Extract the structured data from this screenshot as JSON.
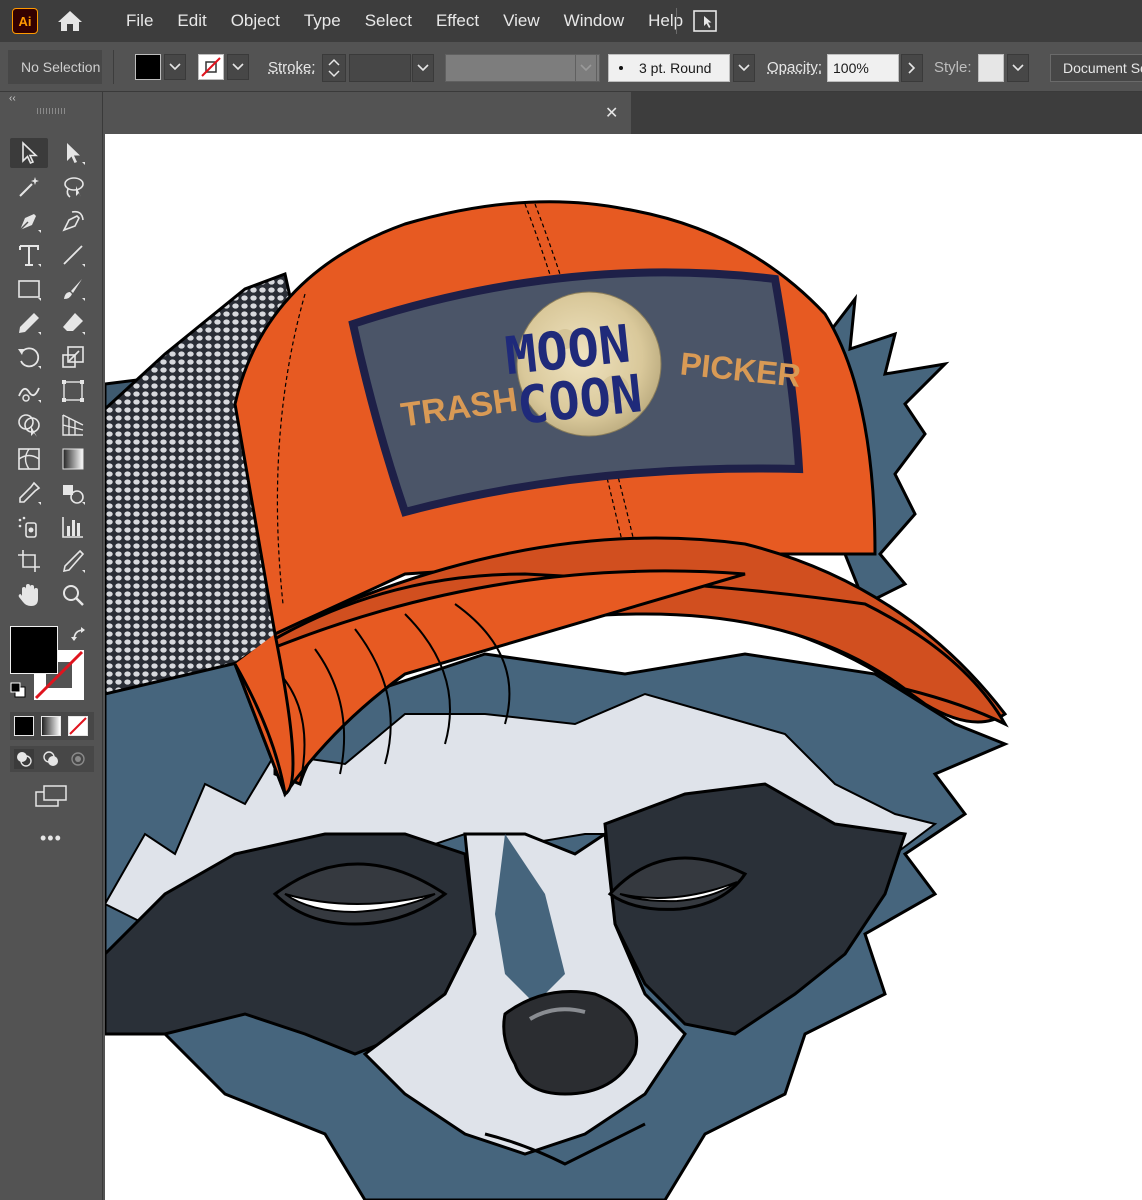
{
  "app": {
    "logo_text": "Ai"
  },
  "menu": [
    "File",
    "Edit",
    "Object",
    "Type",
    "Select",
    "Effect",
    "View",
    "Window",
    "Help"
  ],
  "control_bar": {
    "selection_status": "No Selection",
    "stroke_label": "Stroke:",
    "brush": "3 pt. Round",
    "opacity_label": "Opacity:",
    "opacity_value": "100%",
    "style_label": "Style:",
    "document_setup": "Document Setup"
  },
  "tools": [
    {
      "name": "selection-tool-icon",
      "active": true
    },
    {
      "name": "direct-selection-tool-icon"
    },
    {
      "name": "magic-wand-tool-icon"
    },
    {
      "name": "lasso-tool-icon"
    },
    {
      "name": "pen-tool-icon"
    },
    {
      "name": "curvature-tool-icon"
    },
    {
      "name": "type-tool-icon"
    },
    {
      "name": "line-tool-icon"
    },
    {
      "name": "rectangle-tool-icon"
    },
    {
      "name": "paintbrush-tool-icon"
    },
    {
      "name": "pencil-tool-icon"
    },
    {
      "name": "eraser-tool-icon"
    },
    {
      "name": "rotate-tool-icon"
    },
    {
      "name": "scale-tool-icon"
    },
    {
      "name": "warp-tool-icon"
    },
    {
      "name": "free-transform-tool-icon"
    },
    {
      "name": "shape-builder-tool-icon"
    },
    {
      "name": "perspective-grid-tool-icon"
    },
    {
      "name": "mesh-tool-icon"
    },
    {
      "name": "gradient-tool-icon"
    },
    {
      "name": "eyedropper-tool-icon"
    },
    {
      "name": "blend-tool-icon"
    },
    {
      "name": "symbol-sprayer-tool-icon"
    },
    {
      "name": "column-graph-tool-icon"
    },
    {
      "name": "artboard-tool-icon"
    },
    {
      "name": "slice-tool-icon"
    },
    {
      "name": "hand-tool-icon"
    },
    {
      "name": "zoom-tool-icon"
    }
  ],
  "colors": {
    "fill": "#000000",
    "stroke": "none",
    "cap_orange": "#e75a22",
    "cap_brim": "#d14f1f",
    "patch_bg": "#4b5568",
    "patch_border": "#1e2048",
    "patch_text": "#d99a55",
    "raccoon_fur": "#46657d",
    "raccoon_light": "#dfe3ea",
    "raccoon_dark": "#2a3038"
  },
  "artwork": {
    "patch_left": "TRASH",
    "patch_title_1": "MOON",
    "patch_title_2": "COON",
    "patch_right": "PICKER"
  }
}
